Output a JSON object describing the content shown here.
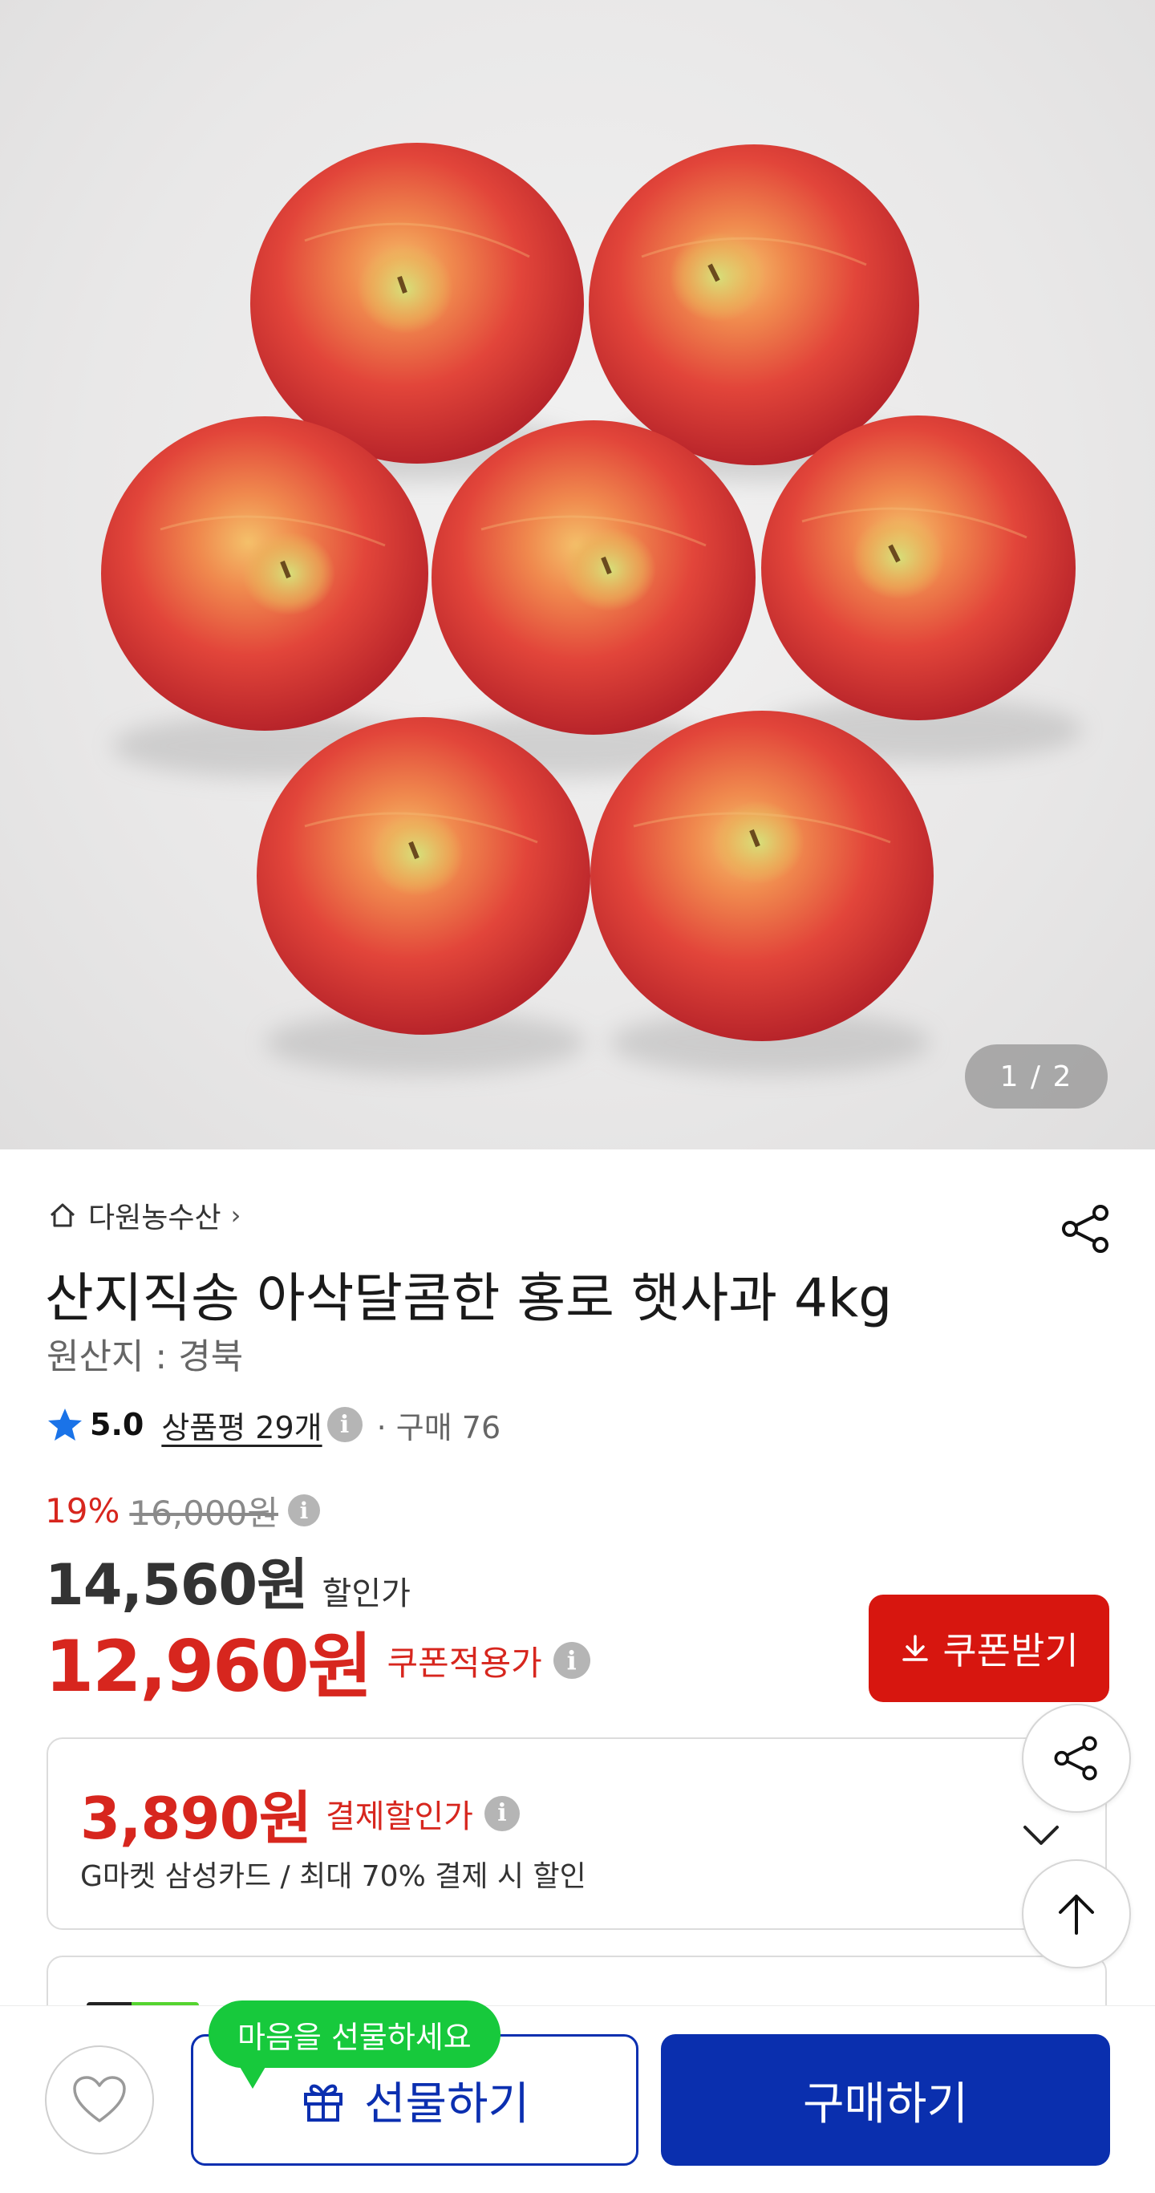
{
  "gallery": {
    "pager": "1 / 2"
  },
  "store": {
    "name": "다원농수산",
    "chevron": "›"
  },
  "product": {
    "title": "산지직송 아삭달콤한 홍로 햇사과 4kg",
    "origin": "원산지 : 경북"
  },
  "rating": {
    "score": "5.0",
    "reviews": "상품평 29개",
    "info": "i",
    "purchases": "· 구매 76",
    "star_color": "#1a73e8"
  },
  "price": {
    "discount_rate": "19%",
    "original_price": "16,000원",
    "sale_price": "14,560원",
    "sale_label": "할인가",
    "coupon_price": "12,960원",
    "coupon_label": "쿠폰적용가",
    "info": "i"
  },
  "coupon_button": {
    "label": "쿠폰받기",
    "icon": "download-icon",
    "color": "#d7160f"
  },
  "payment_discount": {
    "price": "3,890원",
    "label": "결제할인가",
    "info": "i",
    "description": "G마켓 삼성카드 / 최대 70% 결제 시 할인"
  },
  "floating": {
    "share_icon": "share-icon",
    "top_icon": "arrow-up-icon"
  },
  "bottom_bar": {
    "wishlist_icon": "heart-icon",
    "gift_tooltip": "마음을 선물하세요",
    "gift_label": "선물하기",
    "buy_label": "구매하기",
    "accent_color": "#0a2fae",
    "tooltip_color": "#17c93c"
  }
}
